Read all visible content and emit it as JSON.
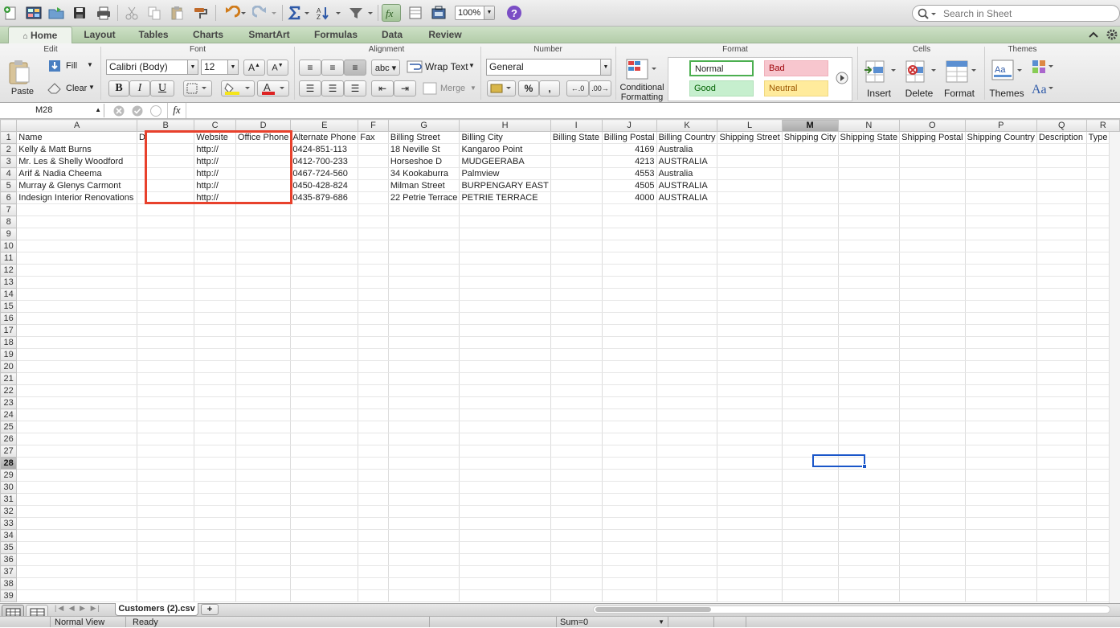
{
  "toolbar": {
    "zoom": "100%",
    "search_placeholder": "Search in Sheet"
  },
  "tabs": [
    "Home",
    "Layout",
    "Tables",
    "Charts",
    "SmartArt",
    "Formulas",
    "Data",
    "Review"
  ],
  "ribbon": {
    "groups": {
      "edit": "Edit",
      "font": "Font",
      "alignment": "Alignment",
      "number": "Number",
      "format": "Format",
      "cells": "Cells",
      "themes": "Themes"
    },
    "paste": "Paste",
    "fill": "Fill",
    "clear": "Clear",
    "font_name": "Calibri (Body)",
    "font_size": "12",
    "bold": "B",
    "italic": "I",
    "underline": "U",
    "wrap_text": "Wrap Text",
    "merge": "Merge",
    "number_format": "General",
    "percent": "%",
    "comma": ",",
    "conditional_formatting_1": "Conditional",
    "conditional_formatting_2": "Formatting",
    "styles": {
      "normal": "Normal",
      "bad": "Bad",
      "good": "Good",
      "neutral": "Neutral"
    },
    "insert": "Insert",
    "delete": "Delete",
    "format": "Format",
    "themes": "Themes"
  },
  "formula_bar": {
    "cell_ref": "M28",
    "fx": "fx",
    "value": ""
  },
  "grid": {
    "columns": [
      "A",
      "B",
      "C",
      "D",
      "E",
      "F",
      "G",
      "H",
      "I",
      "J",
      "K",
      "L",
      "M",
      "N",
      "O",
      "P",
      "Q",
      "R"
    ],
    "selected_column": "M",
    "selected_row": 28,
    "row_count": 39,
    "rows": [
      [
        "Name",
        "D",
        "Website",
        "Office Phone",
        "Alternate Phone",
        "Fax",
        "Billing Street",
        "Billing City",
        "Billing State",
        "Billing Postal",
        "Billing Country",
        "Shipping Street",
        "Shipping City",
        "Shipping State",
        "Shipping Postal",
        "Shipping Country",
        "Description",
        "Type"
      ],
      [
        "Kelly & Matt Burns",
        "",
        "http://",
        "",
        "0424-851-113",
        "",
        "18 Neville St",
        "Kangaroo Point",
        "",
        "4169",
        "Australia",
        "",
        "",
        "",
        "",
        "",
        "",
        ""
      ],
      [
        "Mr. Les & Shelly Woodford",
        "",
        "http://",
        "",
        "0412-700-233",
        "",
        "Horseshoe D",
        "MUDGEERABA",
        "",
        "4213",
        "AUSTRALIA",
        "",
        "",
        "",
        "",
        "",
        "",
        ""
      ],
      [
        "Arif & Nadia Cheema",
        "",
        "http://",
        "",
        "0467-724-560",
        "",
        "34 Kookaburra",
        "Palmview",
        "",
        "4553",
        "Australia",
        "",
        "",
        "",
        "",
        "",
        "",
        ""
      ],
      [
        "Murray & Glenys Carmont",
        "",
        "http://",
        "",
        "0450-428-824",
        "",
        "Milman Street",
        "BURPENGARY EAST",
        "",
        "4505",
        "AUSTRALIA",
        "",
        "",
        "",
        "",
        "",
        "",
        ""
      ],
      [
        "Indesign Interior Renovations",
        "",
        "http://",
        "",
        "0435-879-686",
        "",
        "22 Petrie Terrace",
        "PETRIE TERRACE",
        "",
        "4000",
        "AUSTRALIA",
        "",
        "",
        "",
        "",
        "",
        "",
        ""
      ]
    ]
  },
  "sheet_tab": "Customers (2).csv",
  "status": {
    "view": "Normal View",
    "state": "Ready",
    "sum": "Sum=0"
  },
  "colors": {
    "highlight_box": "#e8412c",
    "selected_cell": "#1a56c9"
  }
}
